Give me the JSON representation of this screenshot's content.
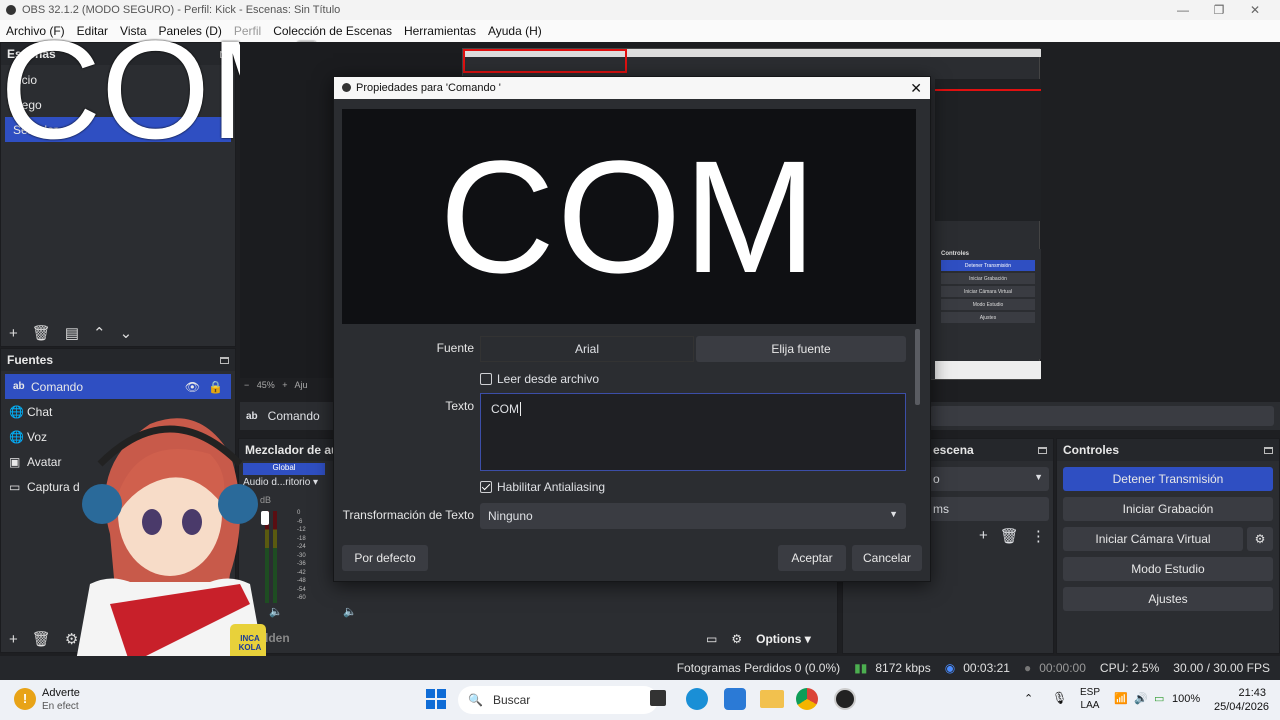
{
  "window": {
    "title": "OBS 32.1.2 (MODO SEGURO) - Perfil: Kick - Escenas: Sin Título"
  },
  "menu": [
    "Archivo (F)",
    "Editar",
    "Vista",
    "Paneles (D)",
    "Perfil",
    "Colección de Escenas",
    "Herramientas",
    "Ayuda (H)"
  ],
  "overlay_text": "COM",
  "scenes": {
    "title": "Escenas",
    "items": [
      "Inicio",
      "Juego",
      "Servidor"
    ]
  },
  "sources": {
    "title": "Fuentes",
    "items": [
      "Comando",
      "Chat",
      "Voz",
      "Avatar",
      "Captura d"
    ]
  },
  "preview": {
    "zoom": "45%",
    "zoom_label": "Aju",
    "source_label": "Comando"
  },
  "mixer": {
    "title": "Mezclador de au",
    "global": "Global",
    "channel": "Audio d...ritorio",
    "db": "0.0 dB",
    "scale": [
      "0",
      "-6",
      "-12",
      "-18",
      "-24",
      "-30",
      "-36",
      "-42",
      "-48",
      "-54",
      "-60"
    ],
    "hidden_label": "dden"
  },
  "transitions": {
    "title": "escena",
    "select1": "o",
    "select2": "ms"
  },
  "controls": {
    "title": "Controles",
    "buttons": [
      "Detener Transmisión",
      "Iniciar Grabación",
      "Iniciar Cámara Virtual",
      "Modo Estudio",
      "Ajustes"
    ]
  },
  "options_label": "Options",
  "dialog": {
    "title": "Propiedades para 'Comando '",
    "font_label": "Fuente",
    "font_value": "Arial",
    "font_button": "Elija fuente",
    "read_file": "Leer desde archivo",
    "text_label": "Texto",
    "text_value": "COM",
    "antialias": "Habilitar Antialiasing",
    "transform_label": "Transformación de Texto",
    "transform_value": "Ninguno",
    "default_button": "Por defecto",
    "ok_button": "Aceptar",
    "cancel_button": "Cancelar"
  },
  "mini_controls": {
    "title": "Controles",
    "buttons": [
      "Detener Transmisión",
      "Iniciar Grabación",
      "Iniciar Cámara Virtual",
      "Modo Estudio",
      "Ajustes"
    ]
  },
  "status": {
    "frames": "Fotogramas Perdidos 0 (0.0%)",
    "kbps": "8172 kbps",
    "live": "00:03:21",
    "rec": "00:00:00",
    "cpu": "CPU: 2.5%",
    "fps": "30.00 / 30.00 FPS"
  },
  "taskbar": {
    "warn_title": "Adverte",
    "warn_sub": "En efect",
    "search": "Buscar",
    "lang1": "ESP",
    "lang2": "LAA",
    "battery": "100%",
    "time": "21:43",
    "date": "25/04/2026"
  },
  "mug_text": "INCA KOLA",
  "colors": {
    "accent": "#2f4fc2",
    "panel": "#2b2d31"
  }
}
